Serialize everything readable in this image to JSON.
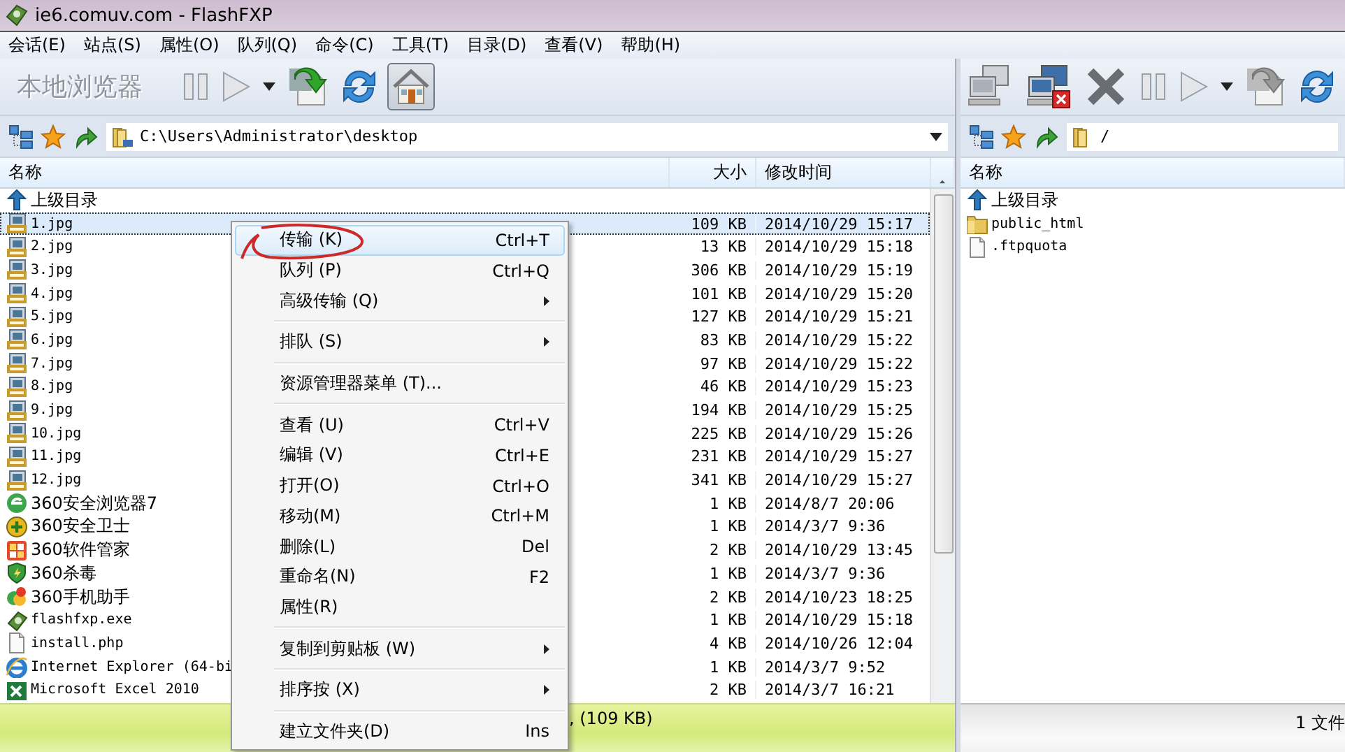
{
  "window": {
    "title": "ie6.comuv.com - FlashFXP"
  },
  "menu_bar": [
    "会话(E)",
    "站点(S)",
    "属性(O)",
    "队列(Q)",
    "命令(C)",
    "工具(T)",
    "目录(D)",
    "查看(V)",
    "帮助(H)"
  ],
  "local": {
    "toolbar": {
      "label": "本地浏览器",
      "buttons": [
        {
          "kind": "pause",
          "pressed": false
        },
        {
          "kind": "play",
          "pressed": false
        },
        {
          "kind": "caret",
          "pressed": false
        },
        {
          "kind": "transfer",
          "pressed": false
        },
        {
          "kind": "refresh",
          "pressed": false
        },
        {
          "kind": "home",
          "pressed": true
        }
      ]
    },
    "path": "C:\\Users\\Administrator\\desktop",
    "columns": [
      "名称",
      "大小",
      "修改时间"
    ],
    "rows": [
      {
        "kind": "up",
        "name": "上级目录",
        "selected": false
      },
      {
        "kind": "jpg",
        "name": "1.jpg",
        "size": "109 KB",
        "modified": "2014/10/29 15:17",
        "selected": true
      },
      {
        "kind": "jpg",
        "name": "2.jpg",
        "size": "13 KB",
        "modified": "2014/10/29 15:18",
        "selected": false
      },
      {
        "kind": "jpg",
        "name": "3.jpg",
        "size": "306 KB",
        "modified": "2014/10/29 15:19",
        "selected": false
      },
      {
        "kind": "jpg",
        "name": "4.jpg",
        "size": "101 KB",
        "modified": "2014/10/29 15:20",
        "selected": false
      },
      {
        "kind": "jpg",
        "name": "5.jpg",
        "size": "127 KB",
        "modified": "2014/10/29 15:21",
        "selected": false
      },
      {
        "kind": "jpg",
        "name": "6.jpg",
        "size": "83 KB",
        "modified": "2014/10/29 15:22",
        "selected": false
      },
      {
        "kind": "jpg",
        "name": "7.jpg",
        "size": "97 KB",
        "modified": "2014/10/29 15:22",
        "selected": false
      },
      {
        "kind": "jpg",
        "name": "8.jpg",
        "size": "46 KB",
        "modified": "2014/10/29 15:23",
        "selected": false
      },
      {
        "kind": "jpg",
        "name": "9.jpg",
        "size": "194 KB",
        "modified": "2014/10/29 15:25",
        "selected": false
      },
      {
        "kind": "jpg",
        "name": "10.jpg",
        "size": "225 KB",
        "modified": "2014/10/29 15:26",
        "selected": false
      },
      {
        "kind": "jpg",
        "name": "11.jpg",
        "size": "231 KB",
        "modified": "2014/10/29 15:27",
        "selected": false
      },
      {
        "kind": "jpg",
        "name": "12.jpg",
        "size": "341 KB",
        "modified": "2014/10/29 15:27",
        "selected": false
      },
      {
        "kind": "browser",
        "name": "360安全浏览器7",
        "size": "1 KB",
        "modified": "2014/8/7 20:06",
        "selected": false
      },
      {
        "kind": "guard",
        "name": "360安全卫士",
        "size": "1 KB",
        "modified": "2014/3/7 9:36",
        "selected": false
      },
      {
        "kind": "grid",
        "name": "360软件管家",
        "size": "2 KB",
        "modified": "2014/10/29 13:45",
        "selected": false
      },
      {
        "kind": "shield",
        "name": "360杀毒",
        "size": "1 KB",
        "modified": "2014/3/7 9:36",
        "selected": false
      },
      {
        "kind": "phone",
        "name": "360手机助手",
        "size": "2 KB",
        "modified": "2014/10/23 18:25",
        "selected": false
      },
      {
        "kind": "exe",
        "name": "flashfxp.exe",
        "size": "1 KB",
        "modified": "2014/10/29 15:18",
        "selected": false
      },
      {
        "kind": "file",
        "name": "install.php",
        "size": "4 KB",
        "modified": "2014/10/26 12:04",
        "selected": false
      },
      {
        "kind": "ie",
        "name": "Internet Explorer (64-bi",
        "size": "1 KB",
        "modified": "2014/3/7 9:52",
        "selected": false
      },
      {
        "kind": "excel",
        "name": "Microsoft Excel 2010",
        "size": "2 KB",
        "modified": "2014/3/7 16:21",
        "selected": false
      }
    ],
    "status": ", (109 KB)"
  },
  "remote": {
    "toolbar": {
      "buttons": [
        {
          "kind": "connect"
        },
        {
          "kind": "disconnect"
        },
        {
          "kind": "abort"
        },
        {
          "kind": "pause"
        },
        {
          "kind": "play"
        },
        {
          "kind": "caret"
        },
        {
          "kind": "transfer-grey"
        },
        {
          "kind": "refresh"
        }
      ]
    },
    "path": "/",
    "columns": [
      "名称"
    ],
    "rows": [
      {
        "kind": "up",
        "name": "上级目录",
        "selected": false
      },
      {
        "kind": "folder",
        "name": "public_html",
        "selected": false
      },
      {
        "kind": "file",
        "name": ".ftpquota",
        "selected": false
      }
    ],
    "status": "1 文件"
  },
  "context_menu": [
    {
      "kind": "item",
      "label": "传输 (K)",
      "shortcut": "Ctrl+T",
      "submenu": false,
      "highlighted": true,
      "circled": true
    },
    {
      "kind": "item",
      "label": "队列 (P)",
      "shortcut": "Ctrl+Q",
      "submenu": false,
      "highlighted": false,
      "circled": false
    },
    {
      "kind": "item",
      "label": "高级传输 (Q)",
      "submenu": true,
      "highlighted": false,
      "circled": false
    },
    {
      "kind": "separator"
    },
    {
      "kind": "item",
      "label": "排队 (S)",
      "submenu": true,
      "highlighted": false,
      "circled": false
    },
    {
      "kind": "separator"
    },
    {
      "kind": "item",
      "label": "资源管理器菜单 (T)...",
      "submenu": false,
      "highlighted": false,
      "circled": false
    },
    {
      "kind": "separator"
    },
    {
      "kind": "item",
      "label": "查看 (U)",
      "shortcut": "Ctrl+V",
      "submenu": false,
      "highlighted": false,
      "circled": false
    },
    {
      "kind": "item",
      "label": "编辑 (V)",
      "shortcut": "Ctrl+E",
      "submenu": false,
      "highlighted": false,
      "circled": false
    },
    {
      "kind": "item",
      "label": "打开(O)",
      "shortcut": "Ctrl+O",
      "submenu": false,
      "highlighted": false,
      "circled": false
    },
    {
      "kind": "item",
      "label": "移动(M)",
      "shortcut": "Ctrl+M",
      "submenu": false,
      "highlighted": false,
      "circled": false
    },
    {
      "kind": "item",
      "label": "删除(L)",
      "shortcut": "Del",
      "submenu": false,
      "highlighted": false,
      "circled": false
    },
    {
      "kind": "item",
      "label": "重命名(N)",
      "shortcut": "F2",
      "submenu": false,
      "highlighted": false,
      "circled": false
    },
    {
      "kind": "item",
      "label": "属性(R)",
      "submenu": false,
      "highlighted": false,
      "circled": false
    },
    {
      "kind": "separator"
    },
    {
      "kind": "item",
      "label": "复制到剪贴板 (W)",
      "submenu": true,
      "highlighted": false,
      "circled": false
    },
    {
      "kind": "separator"
    },
    {
      "kind": "item",
      "label": "排序按 (X)",
      "submenu": true,
      "highlighted": false,
      "circled": false
    },
    {
      "kind": "separator"
    },
    {
      "kind": "item",
      "label": "建立文件夹(D)",
      "shortcut": "Ins",
      "submenu": false,
      "highlighted": false,
      "circled": false
    }
  ]
}
